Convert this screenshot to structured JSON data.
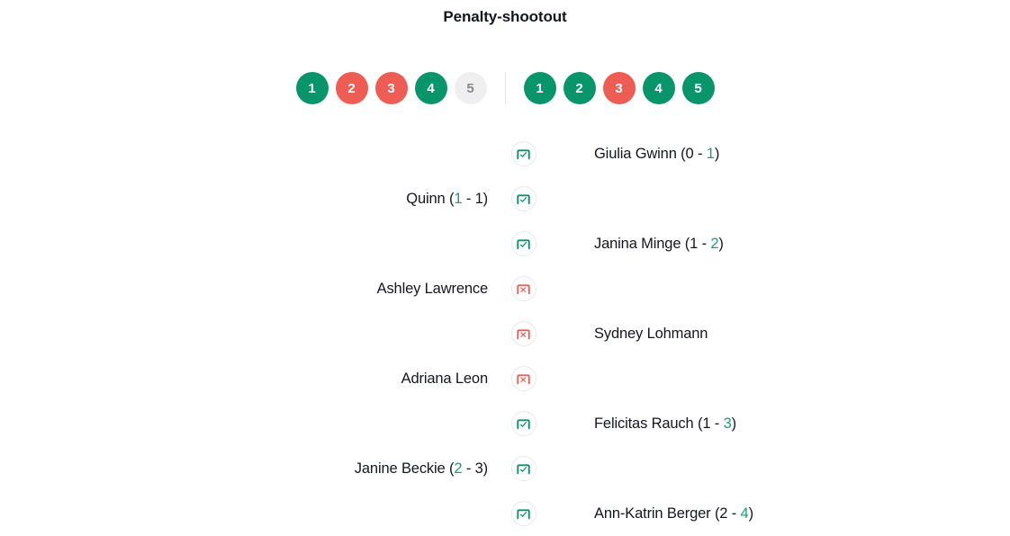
{
  "page": {
    "title": "Penalty-shootout"
  },
  "colors": {
    "scored": "#08956a",
    "missed": "#ee5d54",
    "not_taken": "#efefef",
    "score_highlight": "#1a9e76",
    "text": "#14171f",
    "divider": "#e2e4e8"
  },
  "shootout": {
    "left_team": {
      "badges": [
        {
          "label": "1",
          "state": "scored"
        },
        {
          "label": "2",
          "state": "missed"
        },
        {
          "label": "3",
          "state": "missed"
        },
        {
          "label": "4",
          "state": "scored"
        },
        {
          "label": "5",
          "state": "not_taken"
        }
      ]
    },
    "right_team": {
      "badges": [
        {
          "label": "1",
          "state": "scored"
        },
        {
          "label": "2",
          "state": "scored"
        },
        {
          "label": "3",
          "state": "missed"
        },
        {
          "label": "4",
          "state": "scored"
        },
        {
          "label": "5",
          "state": "scored"
        }
      ]
    },
    "events": [
      {
        "side": "right",
        "outcome": "scored",
        "icon": "goal-scored-icon",
        "player": "Giulia Gwinn",
        "score": {
          "shown": true,
          "home": "0",
          "away": "1",
          "highlight": "away"
        },
        "text": "Giulia Gwinn (0 - 1)"
      },
      {
        "side": "left",
        "outcome": "scored",
        "icon": "goal-scored-icon",
        "player": "Quinn",
        "score": {
          "shown": true,
          "home": "1",
          "away": "1",
          "highlight": "home"
        },
        "text": "Quinn (1 - 1)"
      },
      {
        "side": "right",
        "outcome": "scored",
        "icon": "goal-scored-icon",
        "player": "Janina Minge",
        "score": {
          "shown": true,
          "home": "1",
          "away": "2",
          "highlight": "away"
        },
        "text": "Janina Minge (1 - 2)"
      },
      {
        "side": "left",
        "outcome": "missed",
        "icon": "penalty-missed-icon",
        "player": "Ashley Lawrence",
        "score": {
          "shown": false,
          "home": "",
          "away": "",
          "highlight": "none"
        },
        "text": "Ashley Lawrence"
      },
      {
        "side": "right",
        "outcome": "missed",
        "icon": "penalty-missed-icon",
        "player": "Sydney Lohmann",
        "score": {
          "shown": false,
          "home": "",
          "away": "",
          "highlight": "none"
        },
        "text": "Sydney Lohmann"
      },
      {
        "side": "left",
        "outcome": "missed",
        "icon": "penalty-missed-icon",
        "player": "Adriana Leon",
        "score": {
          "shown": false,
          "home": "",
          "away": "",
          "highlight": "none"
        },
        "text": "Adriana Leon"
      },
      {
        "side": "right",
        "outcome": "scored",
        "icon": "goal-scored-icon",
        "player": "Felicitas Rauch",
        "score": {
          "shown": true,
          "home": "1",
          "away": "3",
          "highlight": "away"
        },
        "text": "Felicitas Rauch (1 - 3)"
      },
      {
        "side": "left",
        "outcome": "scored",
        "icon": "goal-scored-icon",
        "player": "Janine Beckie",
        "score": {
          "shown": true,
          "home": "2",
          "away": "3",
          "highlight": "home"
        },
        "text": "Janine Beckie (2 - 3)"
      },
      {
        "side": "right",
        "outcome": "scored",
        "icon": "goal-scored-icon",
        "player": "Ann-Katrin Berger",
        "score": {
          "shown": true,
          "home": "2",
          "away": "4",
          "highlight": "away"
        },
        "text": "Ann-Katrin Berger (2 - 4)"
      }
    ]
  }
}
